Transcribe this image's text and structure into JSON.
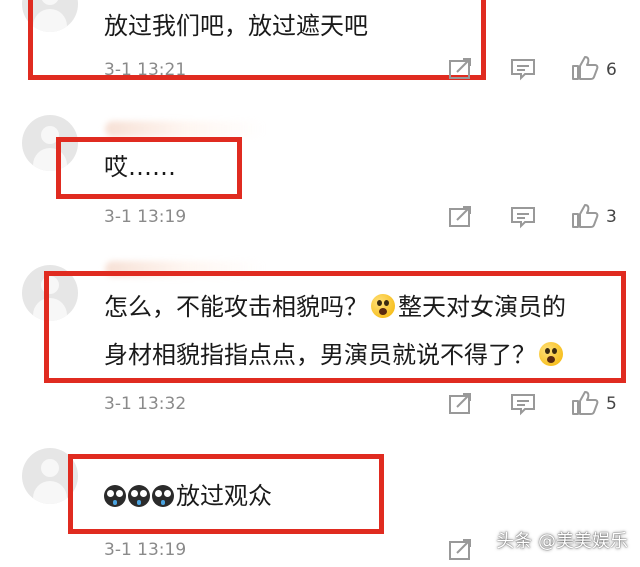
{
  "comments": [
    {
      "text": "放过我们吧，放过遮天吧",
      "time": "3-1 13:21",
      "likes": "6"
    },
    {
      "text": "哎……",
      "time": "3-1 13:19",
      "likes": "3"
    },
    {
      "line1": "怎么，不能攻击相貌吗？",
      "line1b": "整天对女演员的",
      "line2": "身材相貌指指点点，男演员就说不得了？",
      "time": "3-1 13:32",
      "likes": "5"
    },
    {
      "text": "放过观众",
      "time": "3-1 13:19",
      "likes": ""
    }
  ],
  "watermark": "头条 @美美娱乐",
  "colors": {
    "highlight": "#e02b20",
    "meta": "#8a8a8a"
  },
  "icons": [
    "share-icon",
    "reply-icon",
    "like-icon",
    "astonished-emoji",
    "crying-emoji"
  ]
}
